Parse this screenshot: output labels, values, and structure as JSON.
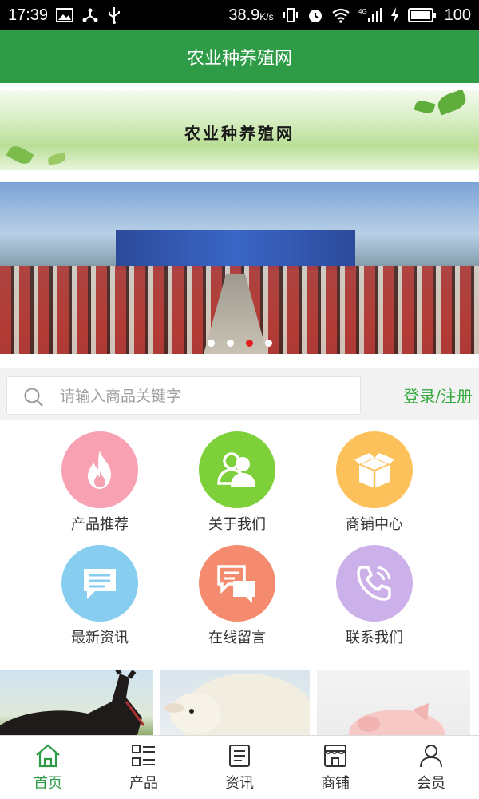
{
  "status_bar": {
    "time": "17:39",
    "net_speed": "38.9",
    "net_unit": "K/s",
    "battery": "100",
    "network_type": "4G"
  },
  "header": {
    "title": "农业种养殖网"
  },
  "banner": {
    "text": "农业种养殖网"
  },
  "carousel": {
    "slide_count": 4,
    "active_index": 2
  },
  "search": {
    "placeholder": "请输入商品关键字",
    "value": ""
  },
  "auth": {
    "login_register": "登录/注册"
  },
  "menu": [
    {
      "label": "产品推荐",
      "icon": "fire-icon",
      "color": "#f7a1b3"
    },
    {
      "label": "关于我们",
      "icon": "users-icon",
      "color": "#7ed03a"
    },
    {
      "label": "商铺中心",
      "icon": "box-icon",
      "color": "#fdc15b"
    },
    {
      "label": "最新资讯",
      "icon": "message-icon",
      "color": "#87cdf0"
    },
    {
      "label": "在线留言",
      "icon": "chat-bubbles-icon",
      "color": "#f48a6e"
    },
    {
      "label": "联系我们",
      "icon": "phone-icon",
      "color": "#cbb0ea"
    }
  ],
  "products": [
    {
      "icon": "donkey-image"
    },
    {
      "icon": "sheep-image"
    },
    {
      "icon": "pig-image"
    }
  ],
  "tabbar": [
    {
      "label": "首页",
      "icon": "home-icon",
      "active": true
    },
    {
      "label": "产品",
      "icon": "product-list-icon",
      "active": false
    },
    {
      "label": "资讯",
      "icon": "news-icon",
      "active": false
    },
    {
      "label": "商铺",
      "icon": "shop-icon",
      "active": false
    },
    {
      "label": "会员",
      "icon": "member-icon",
      "active": false
    }
  ],
  "colors": {
    "brand": "#2e9c47",
    "accent_link": "#33a93f",
    "dot_active": "#e0201e"
  }
}
